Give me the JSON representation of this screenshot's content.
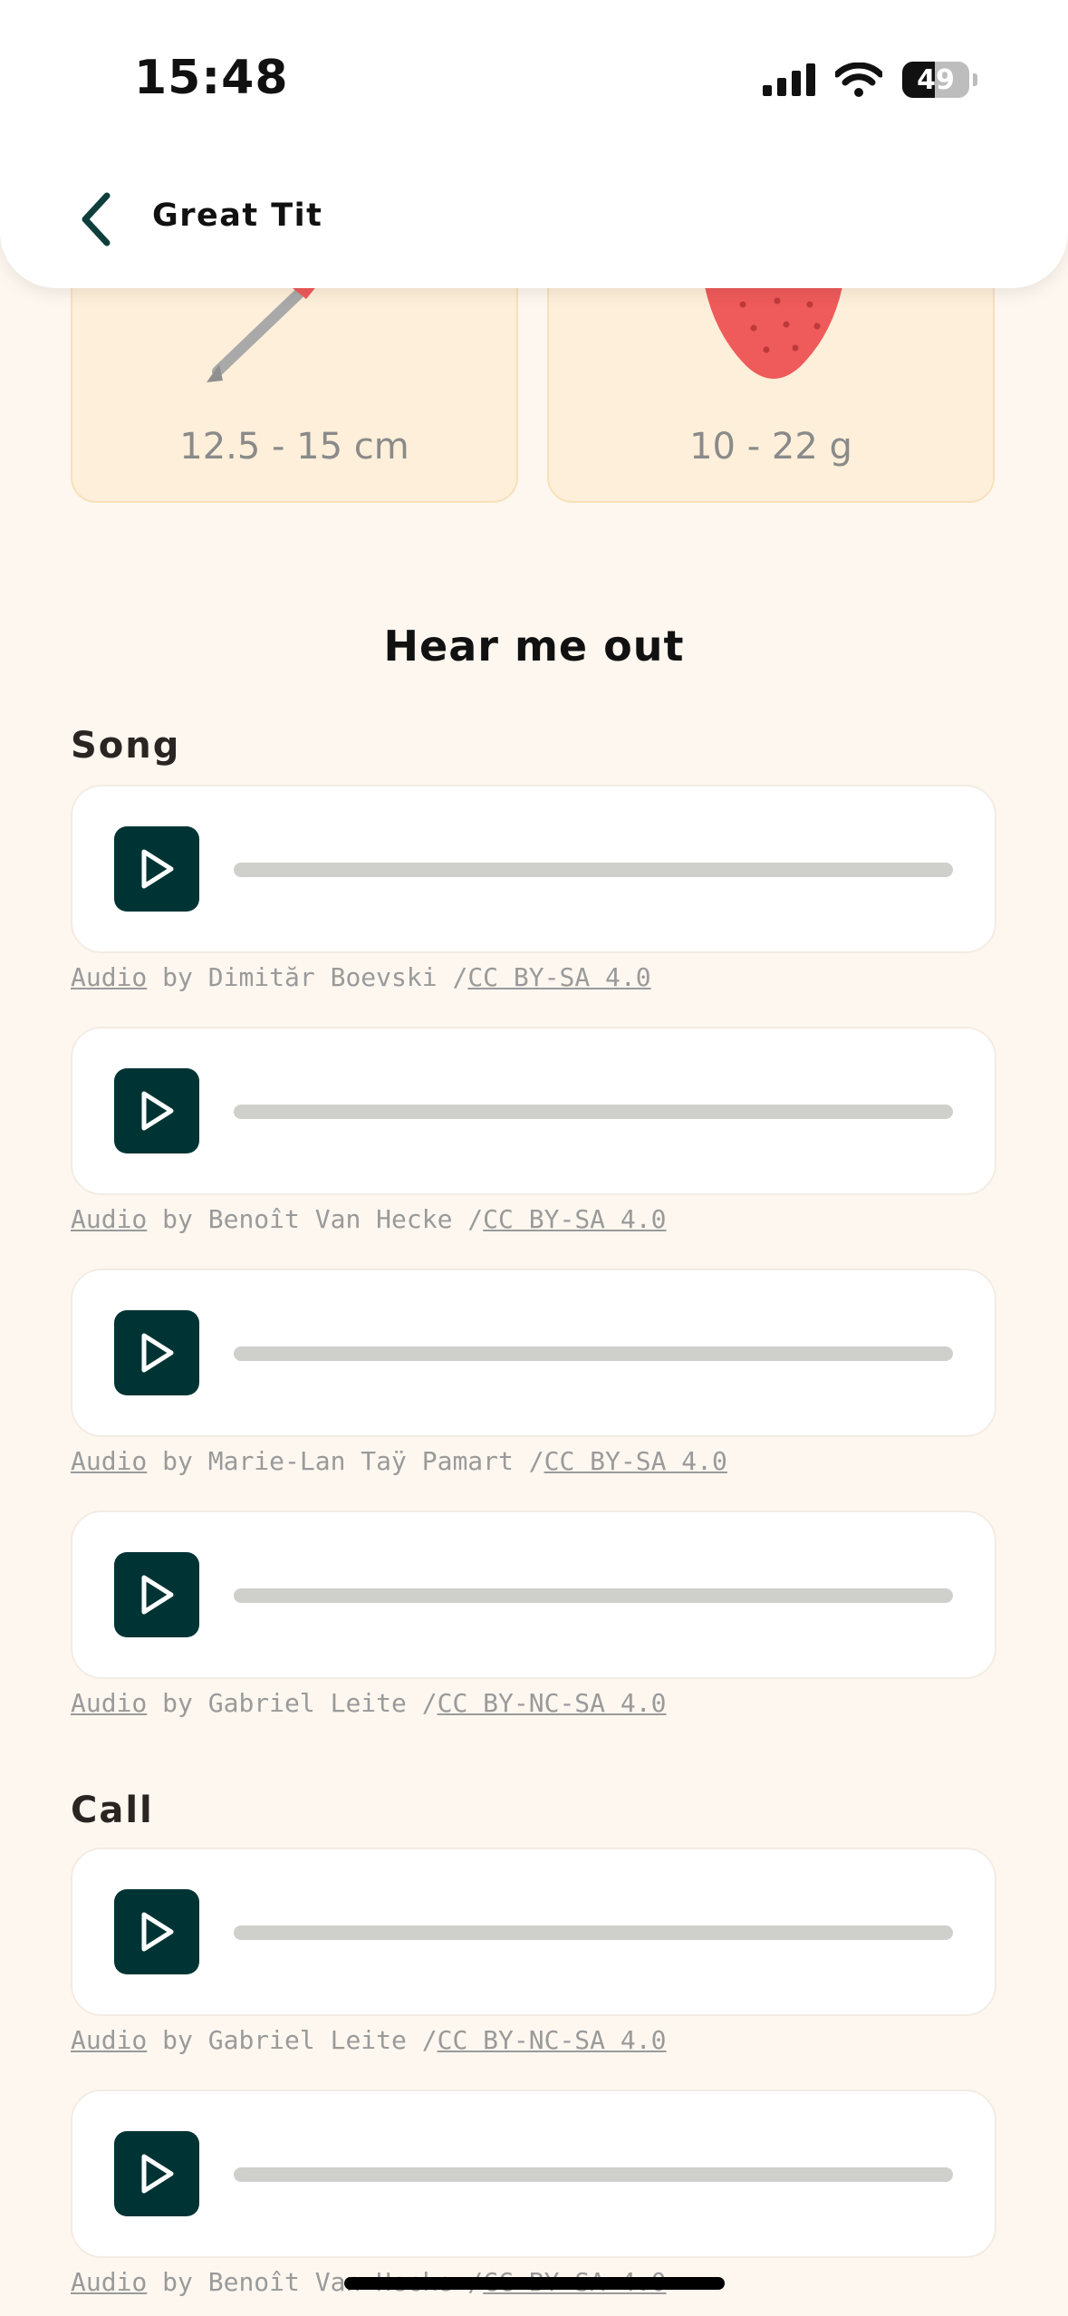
{
  "status_bar": {
    "time": "15:48",
    "battery": "49",
    "battery_level": 0.49
  },
  "header": {
    "title": "Great Tit"
  },
  "stats": [
    {
      "value": "12.5 - 15 cm"
    },
    {
      "value": "10 - 22 g"
    }
  ],
  "section": {
    "heading": "Hear me out"
  },
  "groups": [
    {
      "title": "Song",
      "recordings": [
        {
          "audio_link": "Audio",
          "by": " by Dimităr Boevski /",
          "license": "CC BY-SA 4.0"
        },
        {
          "audio_link": "Audio",
          "by": " by Benoît Van Hecke /",
          "license": "CC BY-SA 4.0"
        },
        {
          "audio_link": "Audio",
          "by": " by Marie-Lan Taÿ Pamart /",
          "license": "CC BY-SA 4.0"
        },
        {
          "audio_link": "Audio",
          "by": " by Gabriel Leite /",
          "license": "CC BY-NC-SA 4.0"
        }
      ]
    },
    {
      "title": "Call",
      "recordings": [
        {
          "audio_link": "Audio",
          "by": " by Gabriel Leite /",
          "license": "CC BY-NC-SA 4.0"
        },
        {
          "audio_link": "Audio",
          "by": " by Benoît Van Hecke /",
          "license": "CC BY-SA 4.0"
        }
      ]
    }
  ],
  "colors": {
    "background": "#fdf7f0",
    "card": "#fdefd9",
    "play_button": "#003434",
    "track": "#cfcfcb",
    "accent_red": "#ef5a5a"
  }
}
